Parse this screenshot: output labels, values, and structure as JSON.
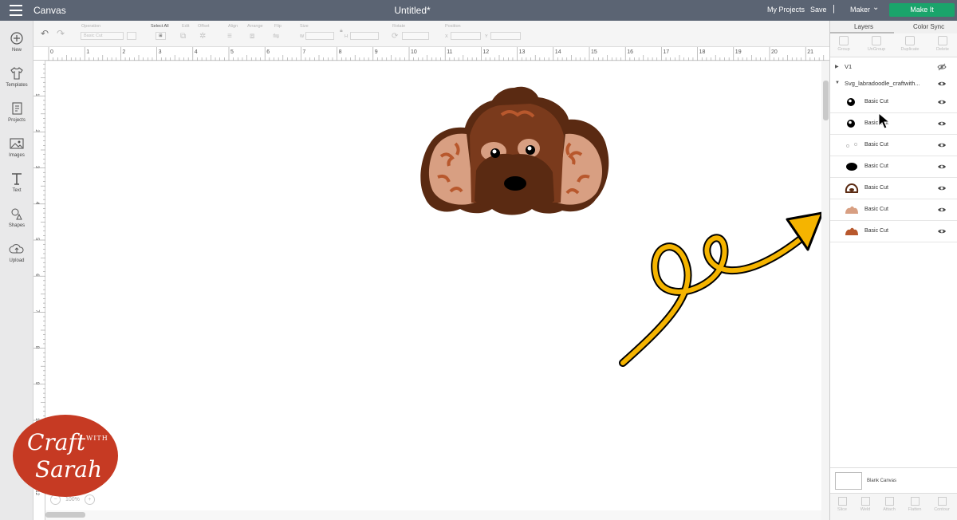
{
  "topbar": {
    "app_title": "Canvas",
    "doc_title": "Untitled*",
    "my_projects": "My Projects",
    "save": "Save",
    "separator": "|",
    "machine": "Maker",
    "make_it": "Make It"
  },
  "sidebar": {
    "items": [
      {
        "label": "New",
        "icon": "plus-circle-icon"
      },
      {
        "label": "Templates",
        "icon": "shirt-icon"
      },
      {
        "label": "Projects",
        "icon": "projects-icon"
      },
      {
        "label": "Images",
        "icon": "image-icon"
      },
      {
        "label": "Text",
        "icon": "text-icon"
      },
      {
        "label": "Shapes",
        "icon": "shapes-icon"
      },
      {
        "label": "Upload",
        "icon": "upload-cloud-icon"
      }
    ]
  },
  "toolbar": {
    "operation_label": "Operation",
    "operation_value": "Basic Cut",
    "select_all": "Select All",
    "edit": "Edit",
    "offset": "Offset",
    "align": "Align",
    "arrange": "Arrange",
    "flip": "Flip",
    "size": "Size",
    "size_w": "W",
    "size_h": "H",
    "rotate": "Rotate",
    "position": "Position",
    "pos_x": "X",
    "pos_y": "Y"
  },
  "rulers": {
    "horizontal": [
      "0",
      "1",
      "2",
      "3",
      "4",
      "5",
      "6",
      "7",
      "8",
      "9",
      "10",
      "11",
      "12",
      "13",
      "14",
      "15",
      "16",
      "17",
      "18",
      "19",
      "20",
      "21"
    ],
    "vertical": [
      "1",
      "2",
      "3",
      "4",
      "5",
      "6",
      "7",
      "8",
      "9",
      "10",
      "11",
      "12"
    ]
  },
  "canvas": {
    "zoom_minus": "−",
    "zoom_level": "100%",
    "zoom_plus": "+"
  },
  "panel": {
    "tab_layers": "Layers",
    "tab_color_sync": "Color Sync",
    "actions": [
      "Group",
      "UnGroup",
      "Duplicate",
      "Delete"
    ],
    "layers": [
      {
        "name": "V1",
        "type": "group",
        "expanded": false
      },
      {
        "name": "Svg_labradoodle_craftwith...",
        "type": "group",
        "expanded": true
      }
    ],
    "sublayers": [
      {
        "name": "Basic Cut",
        "color": "#000000",
        "shape": "eye"
      },
      {
        "name": "Basic Cut",
        "color": "#000000",
        "shape": "eye"
      },
      {
        "name": "Basic Cut",
        "color": "#ffffff",
        "shape": "highlights"
      },
      {
        "name": "Basic Cut",
        "color": "#000000",
        "shape": "nose"
      },
      {
        "name": "Basic Cut",
        "color": "#5a2a12",
        "shape": "head-outline"
      },
      {
        "name": "Basic Cut",
        "color": "#d89f82",
        "shape": "head"
      },
      {
        "name": "Basic Cut",
        "color": "#b8582d",
        "shape": "head"
      }
    ],
    "blank_canvas": "Blank Canvas",
    "bottom_actions": [
      "Slice",
      "Weld",
      "Attach",
      "Flatten",
      "Contour"
    ]
  },
  "logo": {
    "line1": "Craft",
    "line2": "WITH",
    "line3": "Sarah"
  },
  "colors": {
    "topbar": "#5b6473",
    "make_it": "#1aa46b",
    "arrow": "#f5b400",
    "logo": "#c63a23"
  }
}
